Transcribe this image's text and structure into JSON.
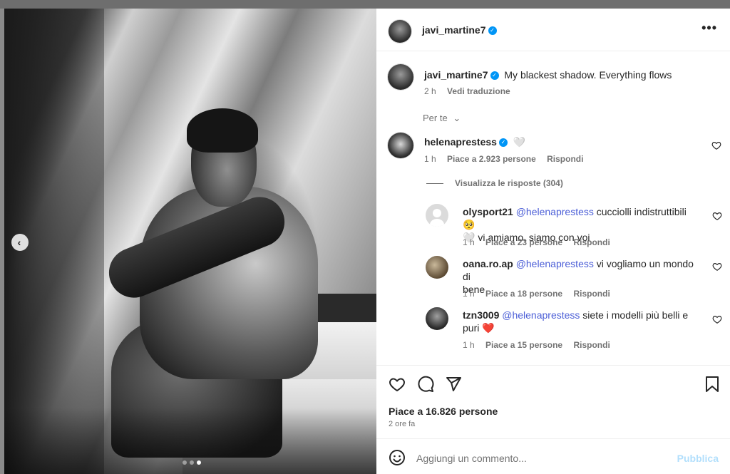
{
  "post": {
    "author": "javi_martine7",
    "caption": "My blackest shadow. Everything flows",
    "caption_time": "2 h",
    "translate_label": "Vedi traduzione",
    "sort_label": "Per te",
    "more_icon": "more-horizontal-icon",
    "likes": "Piace a 16.826 persone",
    "posted": "2 ore fa",
    "carousel": {
      "total_slides": 3,
      "active_index": 2
    }
  },
  "comments": [
    {
      "user": "helenaprestess",
      "verified": true,
      "text": "🤍",
      "time": "1 h",
      "likes": "Piace a 2.923 persone",
      "reply": "Rispondi",
      "view_replies": "Visualizza le risposte (304)"
    }
  ],
  "replies": [
    {
      "user": "olysport21",
      "mention": "@helenaprestess",
      "text_line1": " cucciolli indistruttibili 🥺",
      "text_line2": "🤍 vi amiamo, siamo con voi",
      "time": "1 h",
      "likes": "Piace a 23 persone",
      "reply": "Rispondi"
    },
    {
      "user": "oana.ro.ap",
      "mention": "@helenaprestess",
      "text_line1": " vi vogliamo un mondo di",
      "text_line2": "bene",
      "time": "1 h",
      "likes": "Piace a 18 persone",
      "reply": "Rispondi"
    },
    {
      "user": "tzn3009",
      "mention": "@helenaprestess",
      "text_line1": " siete i modelli più belli e",
      "text_line2": "puri ❤️",
      "time": "1 h",
      "likes": "Piace a 15 persone",
      "reply": "Rispondi"
    }
  ],
  "composer": {
    "placeholder": "Aggiungi un commento...",
    "publish": "Pubblica"
  },
  "colors": {
    "verified": "#0095f6",
    "mention": "#4c5fd7",
    "publish_disabled": "#b2dffc",
    "heart": "#ed4956"
  }
}
